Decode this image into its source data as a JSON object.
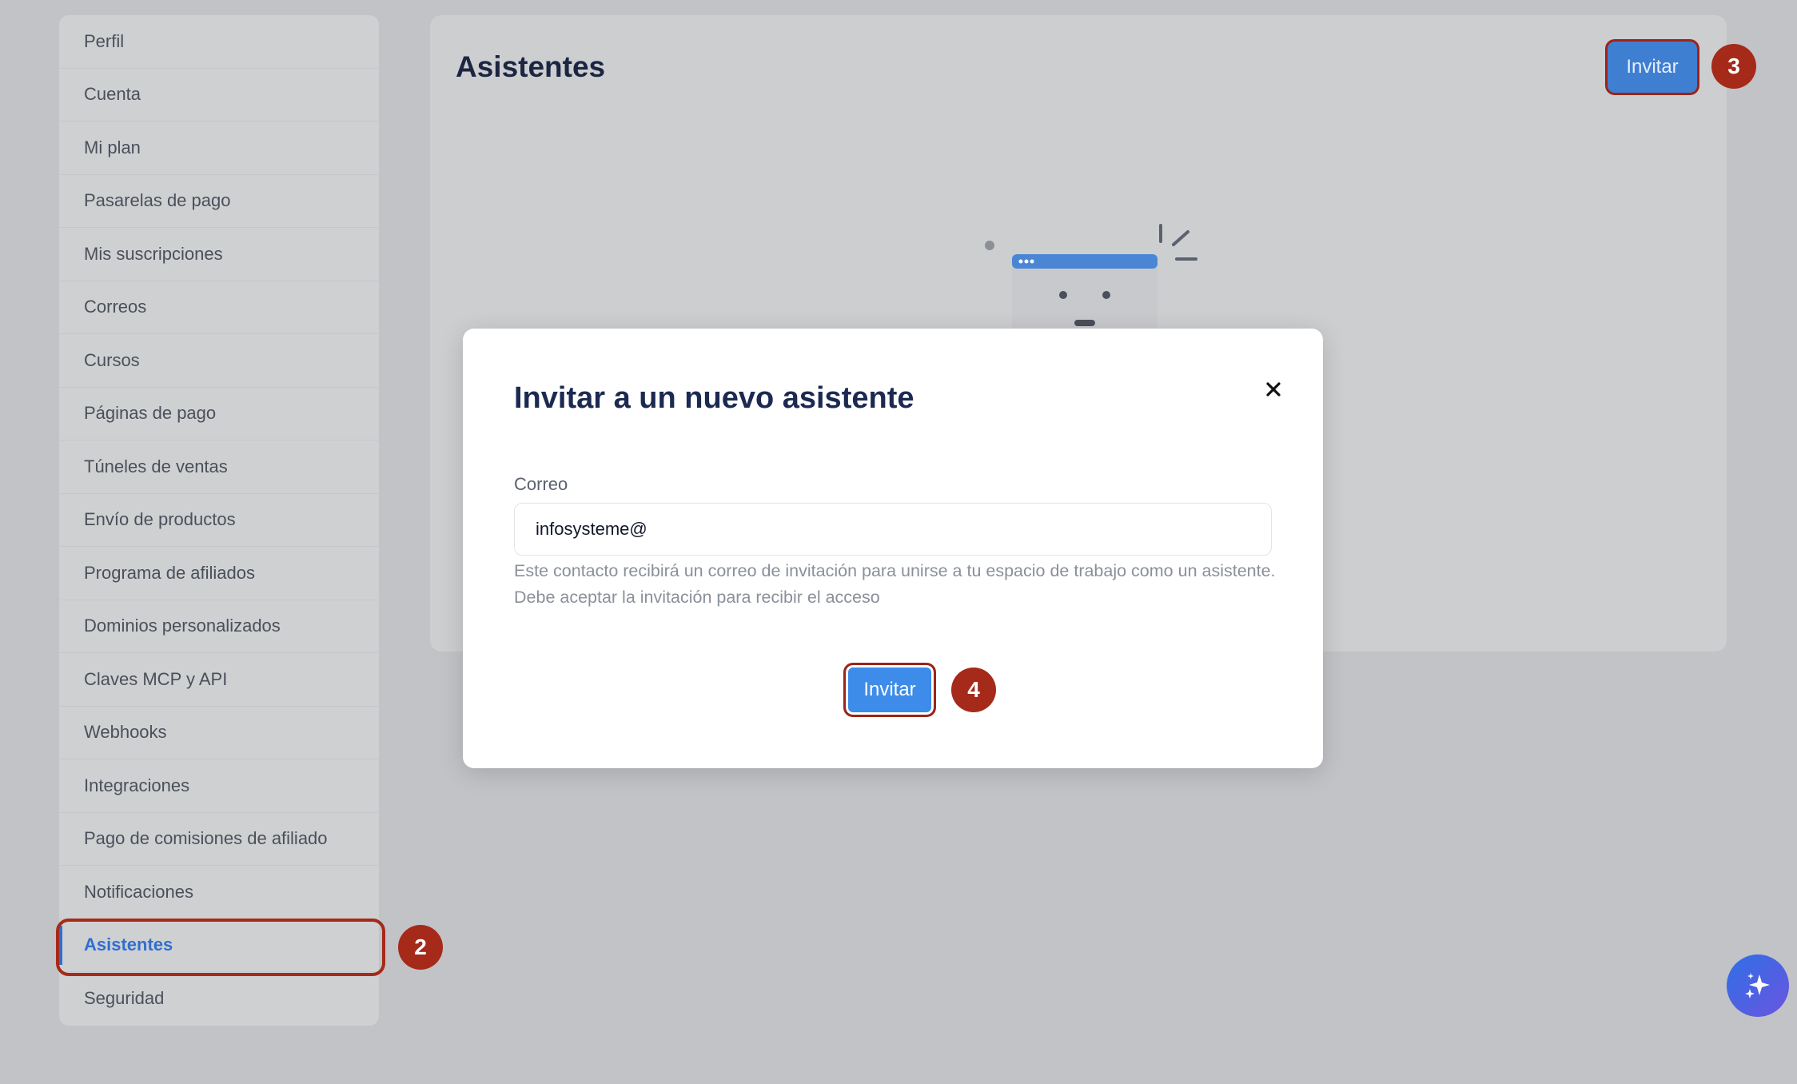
{
  "sidebar": {
    "items": [
      {
        "label": "Perfil"
      },
      {
        "label": "Cuenta"
      },
      {
        "label": "Mi plan"
      },
      {
        "label": "Pasarelas de pago"
      },
      {
        "label": "Mis suscripciones"
      },
      {
        "label": "Correos"
      },
      {
        "label": "Cursos"
      },
      {
        "label": "Páginas de pago"
      },
      {
        "label": "Túneles de ventas"
      },
      {
        "label": "Envío de productos"
      },
      {
        "label": "Programa de afiliados"
      },
      {
        "label": "Dominios personalizados"
      },
      {
        "label": "Claves MCP y API"
      },
      {
        "label": "Webhooks"
      },
      {
        "label": "Integraciones"
      },
      {
        "label": "Pago de comisiones de afiliado"
      },
      {
        "label": "Notificaciones"
      },
      {
        "label": "Asistentes",
        "active": true
      },
      {
        "label": "Seguridad"
      }
    ]
  },
  "main": {
    "title": "Asistentes",
    "invite_label": "Invitar"
  },
  "modal": {
    "title": "Invitar a un nuevo asistente",
    "email_label": "Correo",
    "email_value": "infosysteme@",
    "help_text": "Este contacto recibirá un correo de invitación para unirse a tu espacio de trabajo como un asistente. Debe aceptar la invitación para recibir el acceso",
    "invite_label": "Invitar"
  },
  "steps": {
    "step_2": "2",
    "step_3": "3",
    "step_4": "4"
  },
  "colors": {
    "accent": "#3d8ce9",
    "annotation": "#a52a1a",
    "title": "#1c2a52"
  },
  "icons": {
    "close": "close-icon",
    "fab": "sparkle-icon",
    "illustration": "empty-state-window-icon"
  }
}
